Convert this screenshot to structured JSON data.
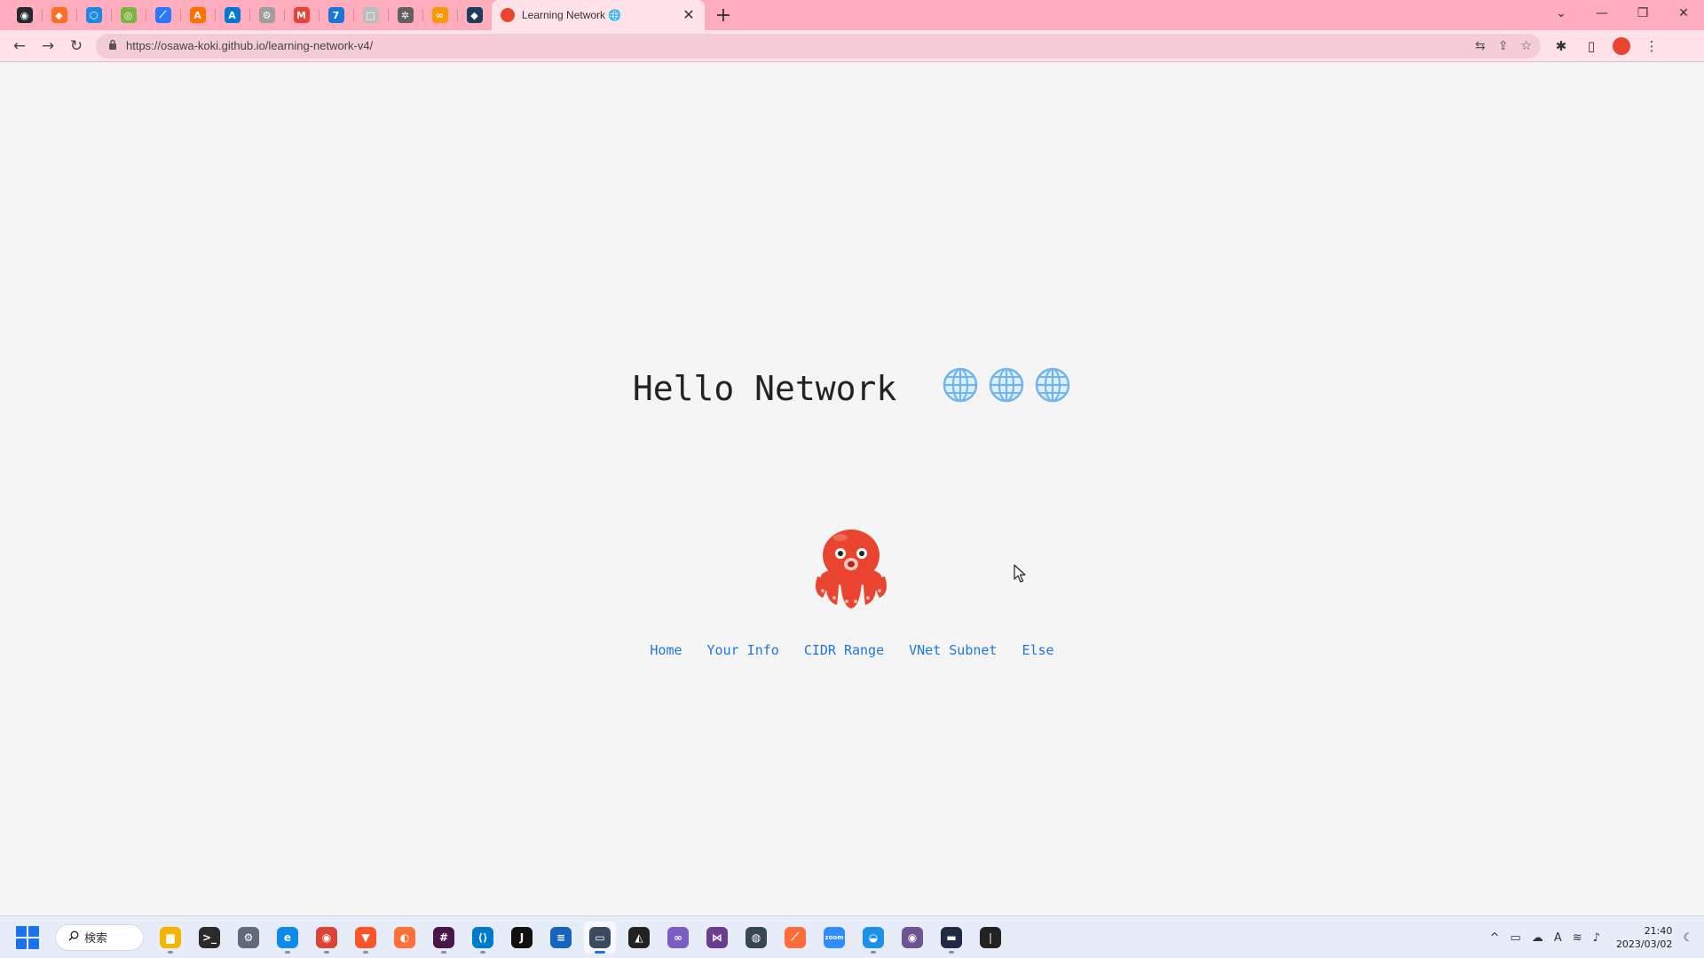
{
  "browser": {
    "active_tab": {
      "title": "Learning Network 🌐",
      "close": "✕"
    },
    "new_tab": "+",
    "pinned_tabs": [
      {
        "icon": "github-icon",
        "color": "#24292f",
        "glyph": "◉"
      },
      {
        "icon": "gitlab-icon",
        "color": "#fc6d26",
        "glyph": "◆"
      },
      {
        "icon": "azure-devops-icon",
        "color": "#1e88e5",
        "glyph": "⬡"
      },
      {
        "icon": "app-icon",
        "color": "#7cb342",
        "glyph": "◎"
      },
      {
        "icon": "power-automate-icon",
        "color": "#2979ff",
        "glyph": "⟋"
      },
      {
        "icon": "aws-icon",
        "color": "#ff6f00",
        "glyph": "A"
      },
      {
        "icon": "azure-icon",
        "color": "#0078d4",
        "glyph": "A"
      },
      {
        "icon": "settings-icon",
        "color": "#9e9e9e",
        "glyph": "⚙"
      },
      {
        "icon": "gmail-icon",
        "color": "#ea4335",
        "glyph": "M"
      },
      {
        "icon": "calendar-icon",
        "color": "#1976d2",
        "glyph": "7"
      },
      {
        "icon": "app-icon",
        "color": "#bdbdbd",
        "glyph": "□"
      },
      {
        "icon": "openai-icon",
        "color": "#616161",
        "glyph": "✲"
      },
      {
        "icon": "app-icon",
        "color": "#ff9800",
        "glyph": "∞"
      },
      {
        "icon": "app-icon",
        "color": "#1e3a5f",
        "glyph": "◆"
      }
    ],
    "window_controls": [
      "⌄",
      "—",
      "❐",
      "✕"
    ],
    "url": "https://osawa-koki.github.io/learning-network-v4/",
    "nav": {
      "back": "←",
      "forward": "→",
      "reload": "↻"
    },
    "omnibox_icons": [
      "⇆",
      "⇪",
      "☆"
    ],
    "toolbar_icons": [
      "✱",
      "▯",
      "⋮"
    ]
  },
  "page": {
    "title": "Hello Network",
    "globe_count": 3,
    "nav_links": [
      "Home",
      "Your Info",
      "CIDR Range",
      "VNet Subnet",
      "Else"
    ]
  },
  "taskbar": {
    "search_label": "検索",
    "apps": [
      {
        "icon": "file-explorer-icon",
        "color": "#f4b400",
        "glyph": "▆",
        "running": true,
        "active": false
      },
      {
        "icon": "terminal-icon",
        "color": "#2b2b2b",
        "glyph": ">_",
        "running": false,
        "active": false
      },
      {
        "icon": "settings-icon",
        "color": "#5f6b7a",
        "glyph": "⚙",
        "running": false,
        "active": false
      },
      {
        "icon": "edge-icon",
        "color": "#0c8ce9",
        "glyph": "e",
        "running": true,
        "active": false
      },
      {
        "icon": "chrome-icon",
        "color": "#db4437",
        "glyph": "◉",
        "running": true,
        "active": false
      },
      {
        "icon": "brave-icon",
        "color": "#fb542b",
        "glyph": "▼",
        "running": true,
        "active": false
      },
      {
        "icon": "firefox-icon",
        "color": "#ff7139",
        "glyph": "◐",
        "running": false,
        "active": false
      },
      {
        "icon": "slack-icon",
        "color": "#4a154b",
        "glyph": "#",
        "running": true,
        "active": false
      },
      {
        "icon": "vscode-icon",
        "color": "#007acc",
        "glyph": "⟨⟩",
        "running": true,
        "active": false
      },
      {
        "icon": "jetbrains-icon",
        "color": "#111",
        "glyph": "J",
        "running": false,
        "active": false
      },
      {
        "icon": "notepad-icon",
        "color": "#1565c0",
        "glyph": "≡",
        "running": false,
        "active": false
      },
      {
        "icon": "remote-desktop-icon",
        "color": "#3a4a5e",
        "glyph": "▭",
        "running": true,
        "active": true
      },
      {
        "icon": "inkscape-icon",
        "color": "#222",
        "glyph": "◭",
        "running": false,
        "active": false
      },
      {
        "icon": "visual-studio-icon",
        "color": "#7b5cc4",
        "glyph": "∞",
        "running": false,
        "active": false
      },
      {
        "icon": "app-icon",
        "color": "#6a3d8f",
        "glyph": "⋈",
        "running": false,
        "active": false
      },
      {
        "icon": "app-icon",
        "color": "#37474f",
        "glyph": "◍",
        "running": false,
        "active": false
      },
      {
        "icon": "postman-icon",
        "color": "#ff6c37",
        "glyph": "⟋",
        "running": false,
        "active": false
      },
      {
        "icon": "zoom-icon",
        "color": "#2d8cff",
        "glyph": "zoom",
        "running": false,
        "active": false
      },
      {
        "icon": "docker-icon",
        "color": "#1d91e6",
        "glyph": "◒",
        "running": true,
        "active": false
      },
      {
        "icon": "github-desktop-icon",
        "color": "#6e5494",
        "glyph": "◉",
        "running": false,
        "active": false
      },
      {
        "icon": "app-icon",
        "color": "#1f2a44",
        "glyph": "▬",
        "running": true,
        "active": false
      },
      {
        "icon": "mongodb-icon",
        "color": "#222",
        "glyph": "❘",
        "running": false,
        "active": false
      }
    ],
    "tray": {
      "chevron": "^",
      "icons": [
        "▭",
        "☁",
        "A",
        "≋",
        "♪"
      ],
      "time": "21:40",
      "date": "2023/03/02",
      "notification": "☾"
    }
  },
  "colors": {
    "tabbar": "#ffacbd",
    "link": "#1e78d8",
    "octopus": "#e8442f",
    "globe": "#6fb6f0"
  }
}
